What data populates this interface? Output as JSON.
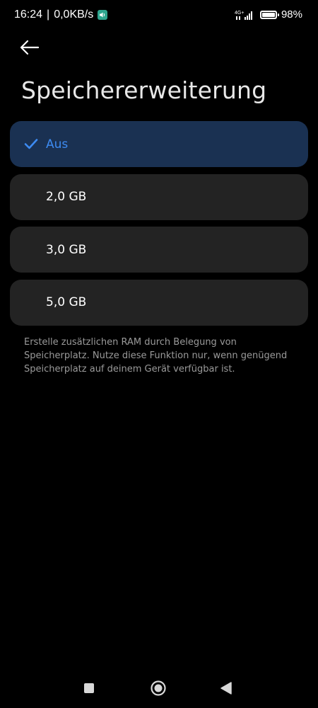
{
  "status_bar": {
    "time": "16:24",
    "separator": "|",
    "net_speed": "0,0KB/s",
    "network_type": "4G+",
    "battery": "98%"
  },
  "header": {
    "back_icon": "arrow-left-icon",
    "title": "Speichererweiterung"
  },
  "options": [
    {
      "label": "Aus",
      "selected": true
    },
    {
      "label": "2,0 GB",
      "selected": false
    },
    {
      "label": "3,0 GB",
      "selected": false
    },
    {
      "label": "5,0 GB",
      "selected": false
    }
  ],
  "description": "Erstelle zusätzlichen RAM durch Belegung von Speicherplatz. Nutze diese Funktion nur, wenn genügend Speicherplatz auf deinem Gerät verfügbar ist.",
  "colors": {
    "background": "#000000",
    "card": "#232323",
    "selected_card": "#1a3152",
    "accent": "#3d8bf2",
    "description_text": "#9a9a9a"
  },
  "nav_bar": {
    "recents_icon": "square-icon",
    "home_icon": "circle-icon",
    "back_icon": "triangle-icon"
  }
}
